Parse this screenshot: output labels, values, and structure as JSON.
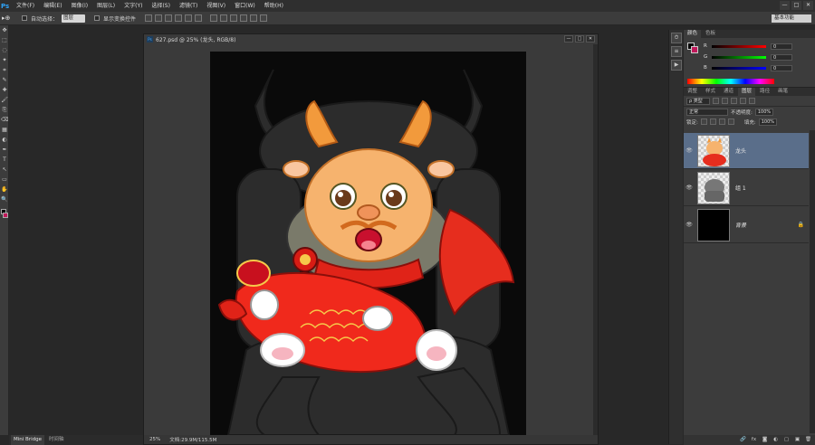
{
  "menu": {
    "logo": "Ps",
    "items": [
      "文件(F)",
      "编辑(E)",
      "图像(I)",
      "图层(L)",
      "文字(Y)",
      "选择(S)",
      "滤镜(T)",
      "视图(V)",
      "窗口(W)",
      "帮助(H)"
    ],
    "window_controls": [
      "—",
      "□",
      "✕"
    ]
  },
  "options": {
    "tool_glyph": "▸⊕",
    "auto_select_label": "自动选择：",
    "auto_select_value": "图层",
    "show_transform_label": "显示变换控件",
    "workspace": "基本功能"
  },
  "toolbar": {
    "tools": [
      "✥",
      "⬚",
      "◌",
      "✦",
      "⌗",
      "✎",
      "✚",
      "🖌",
      "⎘",
      "⌫",
      "▦",
      "◐",
      "✒",
      "T",
      "↖",
      "▭",
      "✋",
      "🔍"
    ]
  },
  "document": {
    "title": "627.psd @ 25% (龙头, RGB/8)",
    "ps_icon": "Ps",
    "controls": [
      "—",
      "□",
      "✕"
    ],
    "zoom": "25%",
    "doc_size": "文档:29.9M/115.5M"
  },
  "color_panel": {
    "tabs": [
      "颜色",
      "色板"
    ],
    "channels": [
      {
        "label": "R",
        "value": "0"
      },
      {
        "label": "G",
        "value": "0"
      },
      {
        "label": "B",
        "value": "0"
      }
    ],
    "fg_color": "#000000",
    "bg_color": "#c0185a"
  },
  "layers_panel": {
    "tabs": [
      "调整",
      "样式",
      "通道",
      "图层",
      "路径",
      "画笔"
    ],
    "active_tab": "图层",
    "filter_type": "ρ 类型",
    "blend_mode": "正常",
    "opacity_label": "不透明度:",
    "opacity_value": "100%",
    "lock_label": "锁定:",
    "fill_label": "填充:",
    "fill_value": "100%",
    "layers": [
      {
        "name": "龙头",
        "selected": true,
        "thumb": "dragon"
      },
      {
        "name": "组 1",
        "selected": false,
        "thumb": "group"
      },
      {
        "name": "背景",
        "selected": false,
        "thumb": "black",
        "locked": true
      }
    ],
    "bottom_icons": [
      "🔗",
      "fx",
      "◙",
      "◐",
      "▢",
      "▣",
      "🗑"
    ]
  },
  "bridge": {
    "tabs": [
      "Mini Bridge",
      "时间轴"
    ]
  }
}
